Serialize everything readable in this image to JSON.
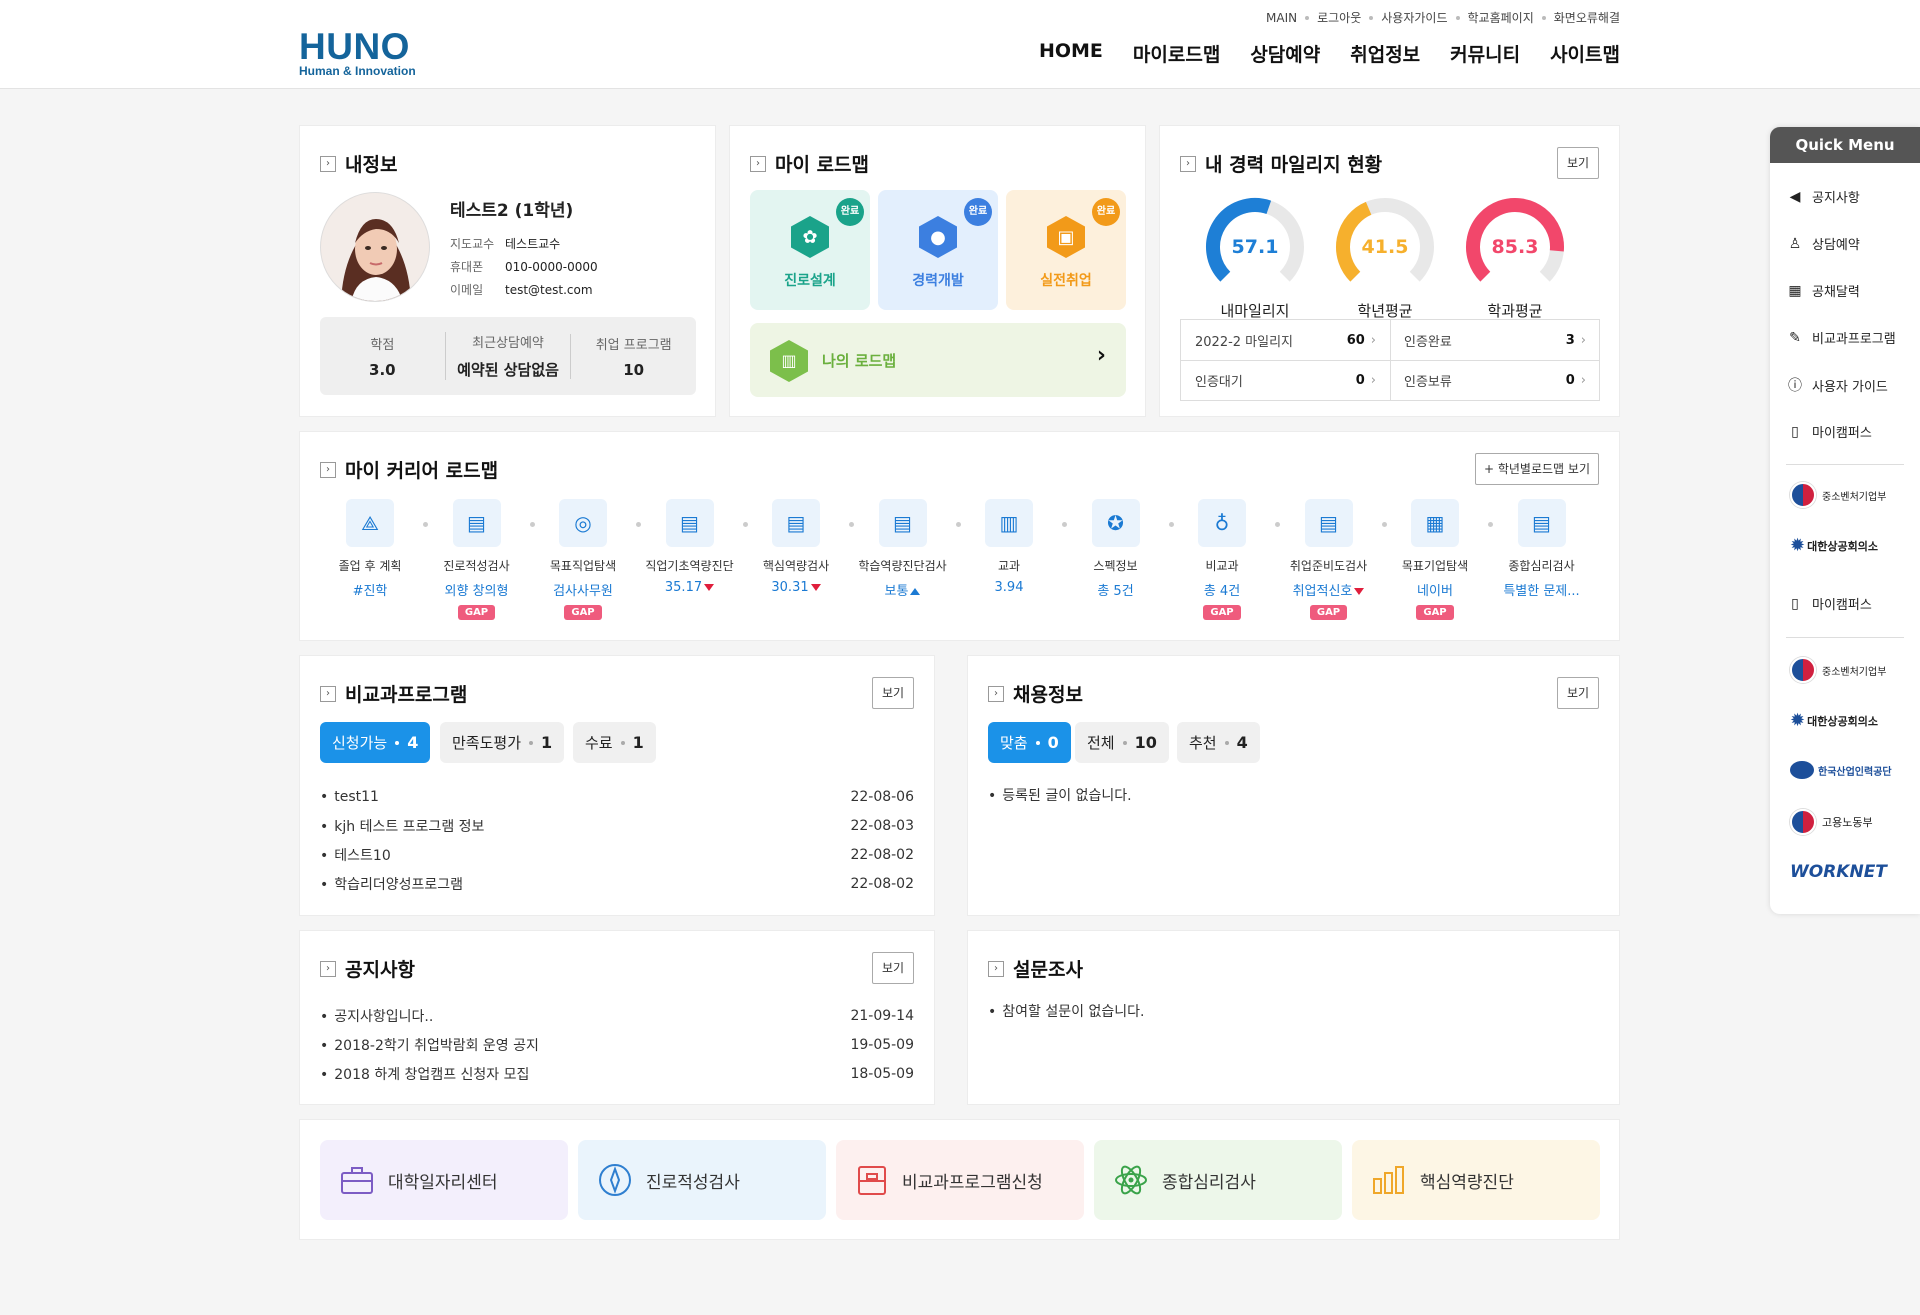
{
  "header": {
    "logo_main": "HUNO",
    "logo_sub": "Human & Innovation",
    "util_links": [
      "MAIN",
      "로그아웃",
      "사용자가이드",
      "학교홈페이지",
      "화면오류해결"
    ],
    "gnb": [
      "HOME",
      "마이로드맵",
      "상담예약",
      "취업정보",
      "커뮤니티",
      "사이트맵"
    ]
  },
  "profile": {
    "title": "내정보",
    "name": "테스트2 (1학년)",
    "rows": [
      {
        "k": "지도교수",
        "v": "테스트교수"
      },
      {
        "k": "휴대폰",
        "v": "010-0000-0000"
      },
      {
        "k": "이메일",
        "v": "test@test.com"
      }
    ],
    "stats": [
      {
        "label": "학점",
        "value": "3.0"
      },
      {
        "label": "최근상담예약",
        "value": "예약된 상담없음"
      },
      {
        "label": "취업 프로그램",
        "value": "10"
      }
    ]
  },
  "my_roadmap": {
    "title": "마이 로드맵",
    "boxes": [
      {
        "label": "진로설계",
        "badge": "완료",
        "bg": "#e3f5f1",
        "fg": "#1aa38a"
      },
      {
        "label": "경력개발",
        "badge": "완료",
        "bg": "#e3effd",
        "fg": "#3c7fe0"
      },
      {
        "label": "실전취업",
        "badge": "완료",
        "bg": "#fdf0dc",
        "fg": "#f29a19"
      }
    ],
    "my_road_label": "나의 로드맵",
    "chevron": "›"
  },
  "mileage": {
    "title": "내 경력 마일리지 현황",
    "view_label": "보기",
    "gauges": [
      {
        "value": "57.1",
        "label": "내마일리지",
        "color": "#1e7fd6",
        "ratio": 0.571
      },
      {
        "value": "41.5",
        "label": "학년평균",
        "color": "#f6b02d",
        "ratio": 0.415
      },
      {
        "value": "85.3",
        "label": "학과평균",
        "color": "#f2476b",
        "ratio": 0.853
      }
    ],
    "cells": [
      {
        "k": "2022-2 마일리지",
        "v": "60"
      },
      {
        "k": "인증완료",
        "v": "3"
      },
      {
        "k": "인증대기",
        "v": "0"
      },
      {
        "k": "인증보류",
        "v": "0"
      }
    ]
  },
  "career_roadmap": {
    "title": "마이 커리어 로드맵",
    "button": "+ 학년별로드맵 보기",
    "steps": [
      {
        "name": "졸업 후 계획",
        "value": "#진학",
        "gap": false,
        "icon": "navigation-icon",
        "glyph": "⟁"
      },
      {
        "name": "진로적성검사",
        "value": "외향 창의형",
        "gap": true,
        "icon": "clipboard-icon",
        "glyph": "▤"
      },
      {
        "name": "목표직업탐색",
        "value": "검사사무원",
        "gap": true,
        "icon": "target-icon",
        "glyph": "◎"
      },
      {
        "name": "직업기초역량진단",
        "value": "35.17",
        "trend": "down",
        "gap": false,
        "icon": "clipboard-icon",
        "glyph": "▤"
      },
      {
        "name": "핵심역량검사",
        "value": "30.31",
        "trend": "down",
        "gap": false,
        "icon": "clipboard-icon",
        "glyph": "▤"
      },
      {
        "name": "학습역량진단검사",
        "value": "보통",
        "trend": "up",
        "gap": false,
        "icon": "clipboard-icon",
        "glyph": "▤"
      },
      {
        "name": "교과",
        "value": "3.94",
        "gap": false,
        "icon": "book-icon",
        "glyph": "▥"
      },
      {
        "name": "스펙정보",
        "value": "총 5건",
        "gap": false,
        "icon": "star-badge-icon",
        "glyph": "✪"
      },
      {
        "name": "비교과",
        "value": "총 4건",
        "gap": true,
        "icon": "lightbulb-icon",
        "glyph": "♁"
      },
      {
        "name": "취업준비도검사",
        "value": "취업적신호",
        "trend": "down",
        "gap": true,
        "icon": "clipboard-icon",
        "glyph": "▤"
      },
      {
        "name": "목표기업탐색",
        "value": "네이버",
        "gap": true,
        "icon": "building-icon",
        "glyph": "▦"
      },
      {
        "name": "종합심리검사",
        "value": "특별한 문제...",
        "gap": false,
        "icon": "clipboard-icon",
        "glyph": "▤"
      }
    ],
    "gap_label": "GAP"
  },
  "nonsubject": {
    "title": "비교과프로그램",
    "view_label": "보기",
    "pills": [
      {
        "label": "신청가능",
        "n": "4"
      },
      {
        "label": "만족도평가",
        "n": "1"
      },
      {
        "label": "수료",
        "n": "1"
      }
    ],
    "items": [
      {
        "t": "test11",
        "d": "22-08-06"
      },
      {
        "t": "kjh 테스트 프로그램 정보",
        "d": "22-08-03"
      },
      {
        "t": "테스트10",
        "d": "22-08-02"
      },
      {
        "t": "학습리더양성프로그램",
        "d": "22-08-02"
      }
    ]
  },
  "jobs": {
    "title": "채용정보",
    "view_label": "보기",
    "pills": [
      {
        "label": "맞춤",
        "n": "0"
      },
      {
        "label": "전체",
        "n": "10"
      },
      {
        "label": "추천",
        "n": "4"
      }
    ],
    "empty": "등록된 글이 없습니다."
  },
  "notice": {
    "title": "공지사항",
    "view_label": "보기",
    "items": [
      {
        "t": "공지사항입니다..",
        "d": "21-09-14"
      },
      {
        "t": "2018-2학기 취업박람회 운영 공지",
        "d": "19-05-09"
      },
      {
        "t": "2018 하계 창업캠프 신청자 모집",
        "d": "18-05-09"
      }
    ]
  },
  "survey": {
    "title": "설문조사",
    "empty": "참여할 설문이 없습니다."
  },
  "quick_links": [
    {
      "label": "대학일자리센터",
      "bg": "#f3effc",
      "fg": "#7c5cc4"
    },
    {
      "label": "진로적성검사",
      "bg": "#eaf4fc",
      "fg": "#2f7fd0"
    },
    {
      "label": "비교과프로그램신청",
      "bg": "#fdf0ef",
      "fg": "#e04b4b"
    },
    {
      "label": "종합심리검사",
      "bg": "#edf7ea",
      "fg": "#3aa34a"
    },
    {
      "label": "핵심역량진단",
      "bg": "#fdf6e5",
      "fg": "#efa72a"
    }
  ],
  "quick_menu": {
    "title": "Quick Menu",
    "items": [
      {
        "label": "공지사항",
        "icon": "megaphone-icon",
        "glyph": "📢"
      },
      {
        "label": "상담예약",
        "icon": "user-icon",
        "glyph": "♙"
      },
      {
        "label": "공채달력",
        "icon": "calendar-icon",
        "glyph": "▦"
      },
      {
        "label": "비교과프로그램",
        "icon": "pencil-icon",
        "glyph": "✎"
      },
      {
        "label": "사용자 가이드",
        "icon": "help-icon",
        "glyph": "?"
      },
      {
        "label": "마이캠퍼스",
        "icon": "mobile-icon",
        "glyph": "▯"
      },
      {
        "label": "마이캠퍼스",
        "icon": "mobile-icon",
        "glyph": "▯"
      }
    ],
    "logos": [
      "중소벤처기업부",
      "대한상공회의소",
      "중소벤처기업부",
      "대한상공회의소",
      "한국산업인력공단",
      "고용노동부",
      "WORKNET"
    ]
  }
}
